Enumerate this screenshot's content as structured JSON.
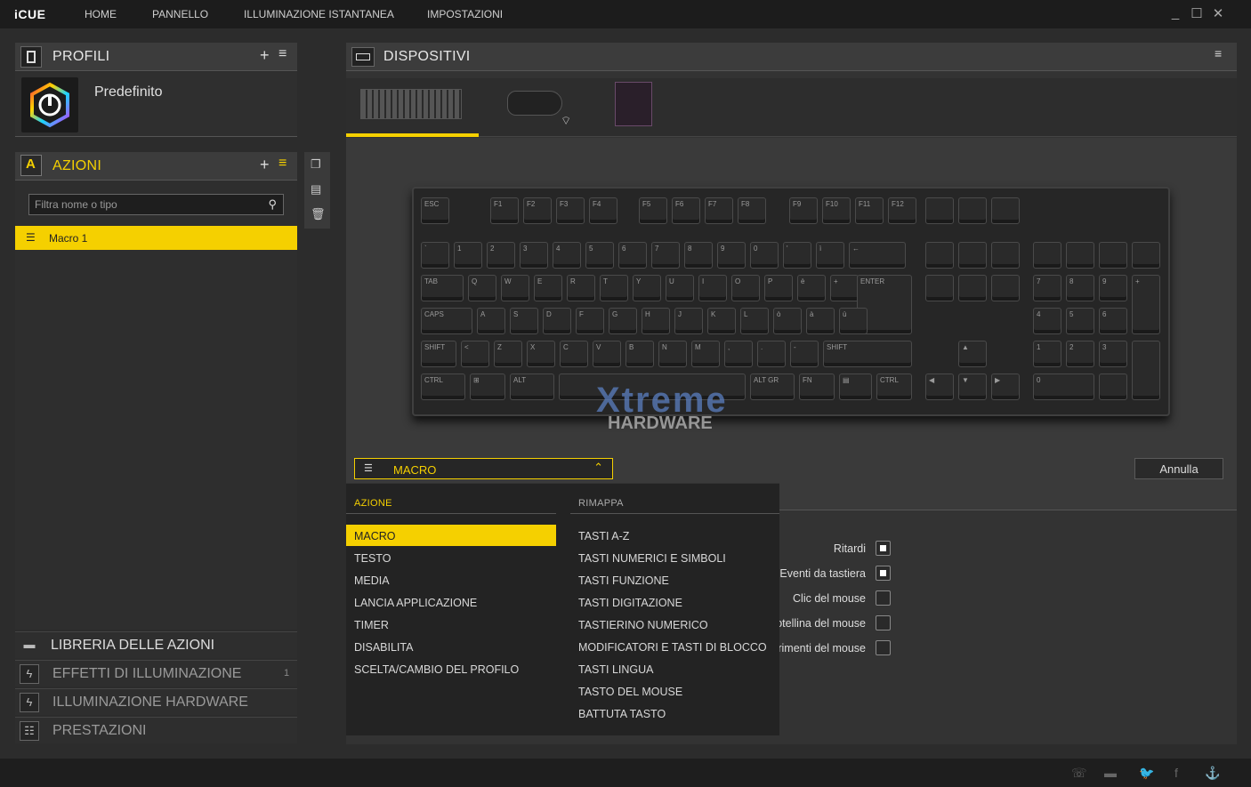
{
  "app": {
    "name": "iCUE"
  },
  "nav": [
    "HOME",
    "PANNELLO",
    "ILLUMINAZIONE ISTANTANEA",
    "IMPOSTAZIONI"
  ],
  "window_controls": {
    "minimize": "_",
    "maximize": "☐",
    "close": "✕"
  },
  "profiles": {
    "title": "PROFILI",
    "profile_name": "Predefinito"
  },
  "actions": {
    "title": "AZIONI",
    "header_icon": "A",
    "filter_placeholder": "Filtra nome o tipo",
    "items": [
      "Macro 1"
    ]
  },
  "library": [
    {
      "label": "LIBRERIA DELLE AZIONI",
      "count": ""
    },
    {
      "label": "EFFETTI DI ILLUMINAZIONE",
      "count": "1"
    },
    {
      "label": "ILLUMINAZIONE HARDWARE",
      "count": ""
    },
    {
      "label": "PRESTAZIONI",
      "count": ""
    }
  ],
  "devices": {
    "title": "DISPOSITIVI",
    "items": [
      "keyboard",
      "mouse",
      "motherboard"
    ]
  },
  "keyboard": {
    "row_fn": [
      "ESC",
      "F1",
      "F2",
      "F3",
      "F4",
      "F5",
      "F6",
      "F7",
      "F8",
      "F9",
      "F10",
      "F11",
      "F12"
    ],
    "row_num": [
      "`",
      "1",
      "2",
      "3",
      "4",
      "5",
      "6",
      "7",
      "8",
      "9",
      "0",
      "'",
      "ì",
      "←"
    ],
    "row_q": [
      "TAB",
      "Q",
      "W",
      "E",
      "R",
      "T",
      "Y",
      "U",
      "I",
      "O",
      "P",
      "è",
      "+",
      "ENTER"
    ],
    "row_a": [
      "CAPS",
      "A",
      "S",
      "D",
      "F",
      "G",
      "H",
      "J",
      "K",
      "L",
      "ò",
      "à",
      "ù"
    ],
    "row_z": [
      "SHIFT",
      "<",
      "Z",
      "X",
      "C",
      "V",
      "B",
      "N",
      "M",
      ",",
      ".",
      "-",
      "SHIFT"
    ],
    "row_ctrl": [
      "CTRL",
      "⊞",
      "ALT",
      "",
      "ALT GR",
      "FN",
      "▤",
      "CTRL"
    ],
    "arrows": [
      "▲",
      "◀",
      "▼",
      "▶"
    ],
    "numpad": [
      "7",
      "8",
      "9",
      "4",
      "5",
      "6",
      "1",
      "2",
      "3",
      "0",
      "+"
    ]
  },
  "watermark": {
    "line1": "Xtreme",
    "line2": "HARDWARE"
  },
  "action_select": {
    "label": "MACRO",
    "cancel": "Annulla"
  },
  "dropdown": {
    "azione_title": "AZIONE",
    "rimappa_title": "RIMAPPA",
    "azione": [
      "MACRO",
      "TESTO",
      "MEDIA",
      "LANCIA APPLICAZIONE",
      "TIMER",
      "DISABILITA",
      "SCELTA/CAMBIO DEL PROFILO"
    ],
    "rimappa": [
      "TASTI A-Z",
      "TASTI NUMERICI E SIMBOLI",
      "TASTI FUNZIONE",
      "TASTI DIGITAZIONE",
      "TASTIERINO NUMERICO",
      "MODIFICATORI E TASTI DI BLOCCO",
      "TASTI LINGUA",
      "TASTO DEL MOUSE",
      "BATTUTA TASTO"
    ]
  },
  "options": [
    {
      "label": "Ritardi",
      "checked": true
    },
    {
      "label": "Eventi da tastiera",
      "checked": true
    },
    {
      "label": "Clic del mouse",
      "checked": false
    },
    {
      "label": "otellina del mouse",
      "checked": false
    },
    {
      "label": "rimenti del mouse",
      "checked": false
    }
  ],
  "colors": {
    "accent": "#f5d000",
    "bg": "#2c2c2c"
  }
}
